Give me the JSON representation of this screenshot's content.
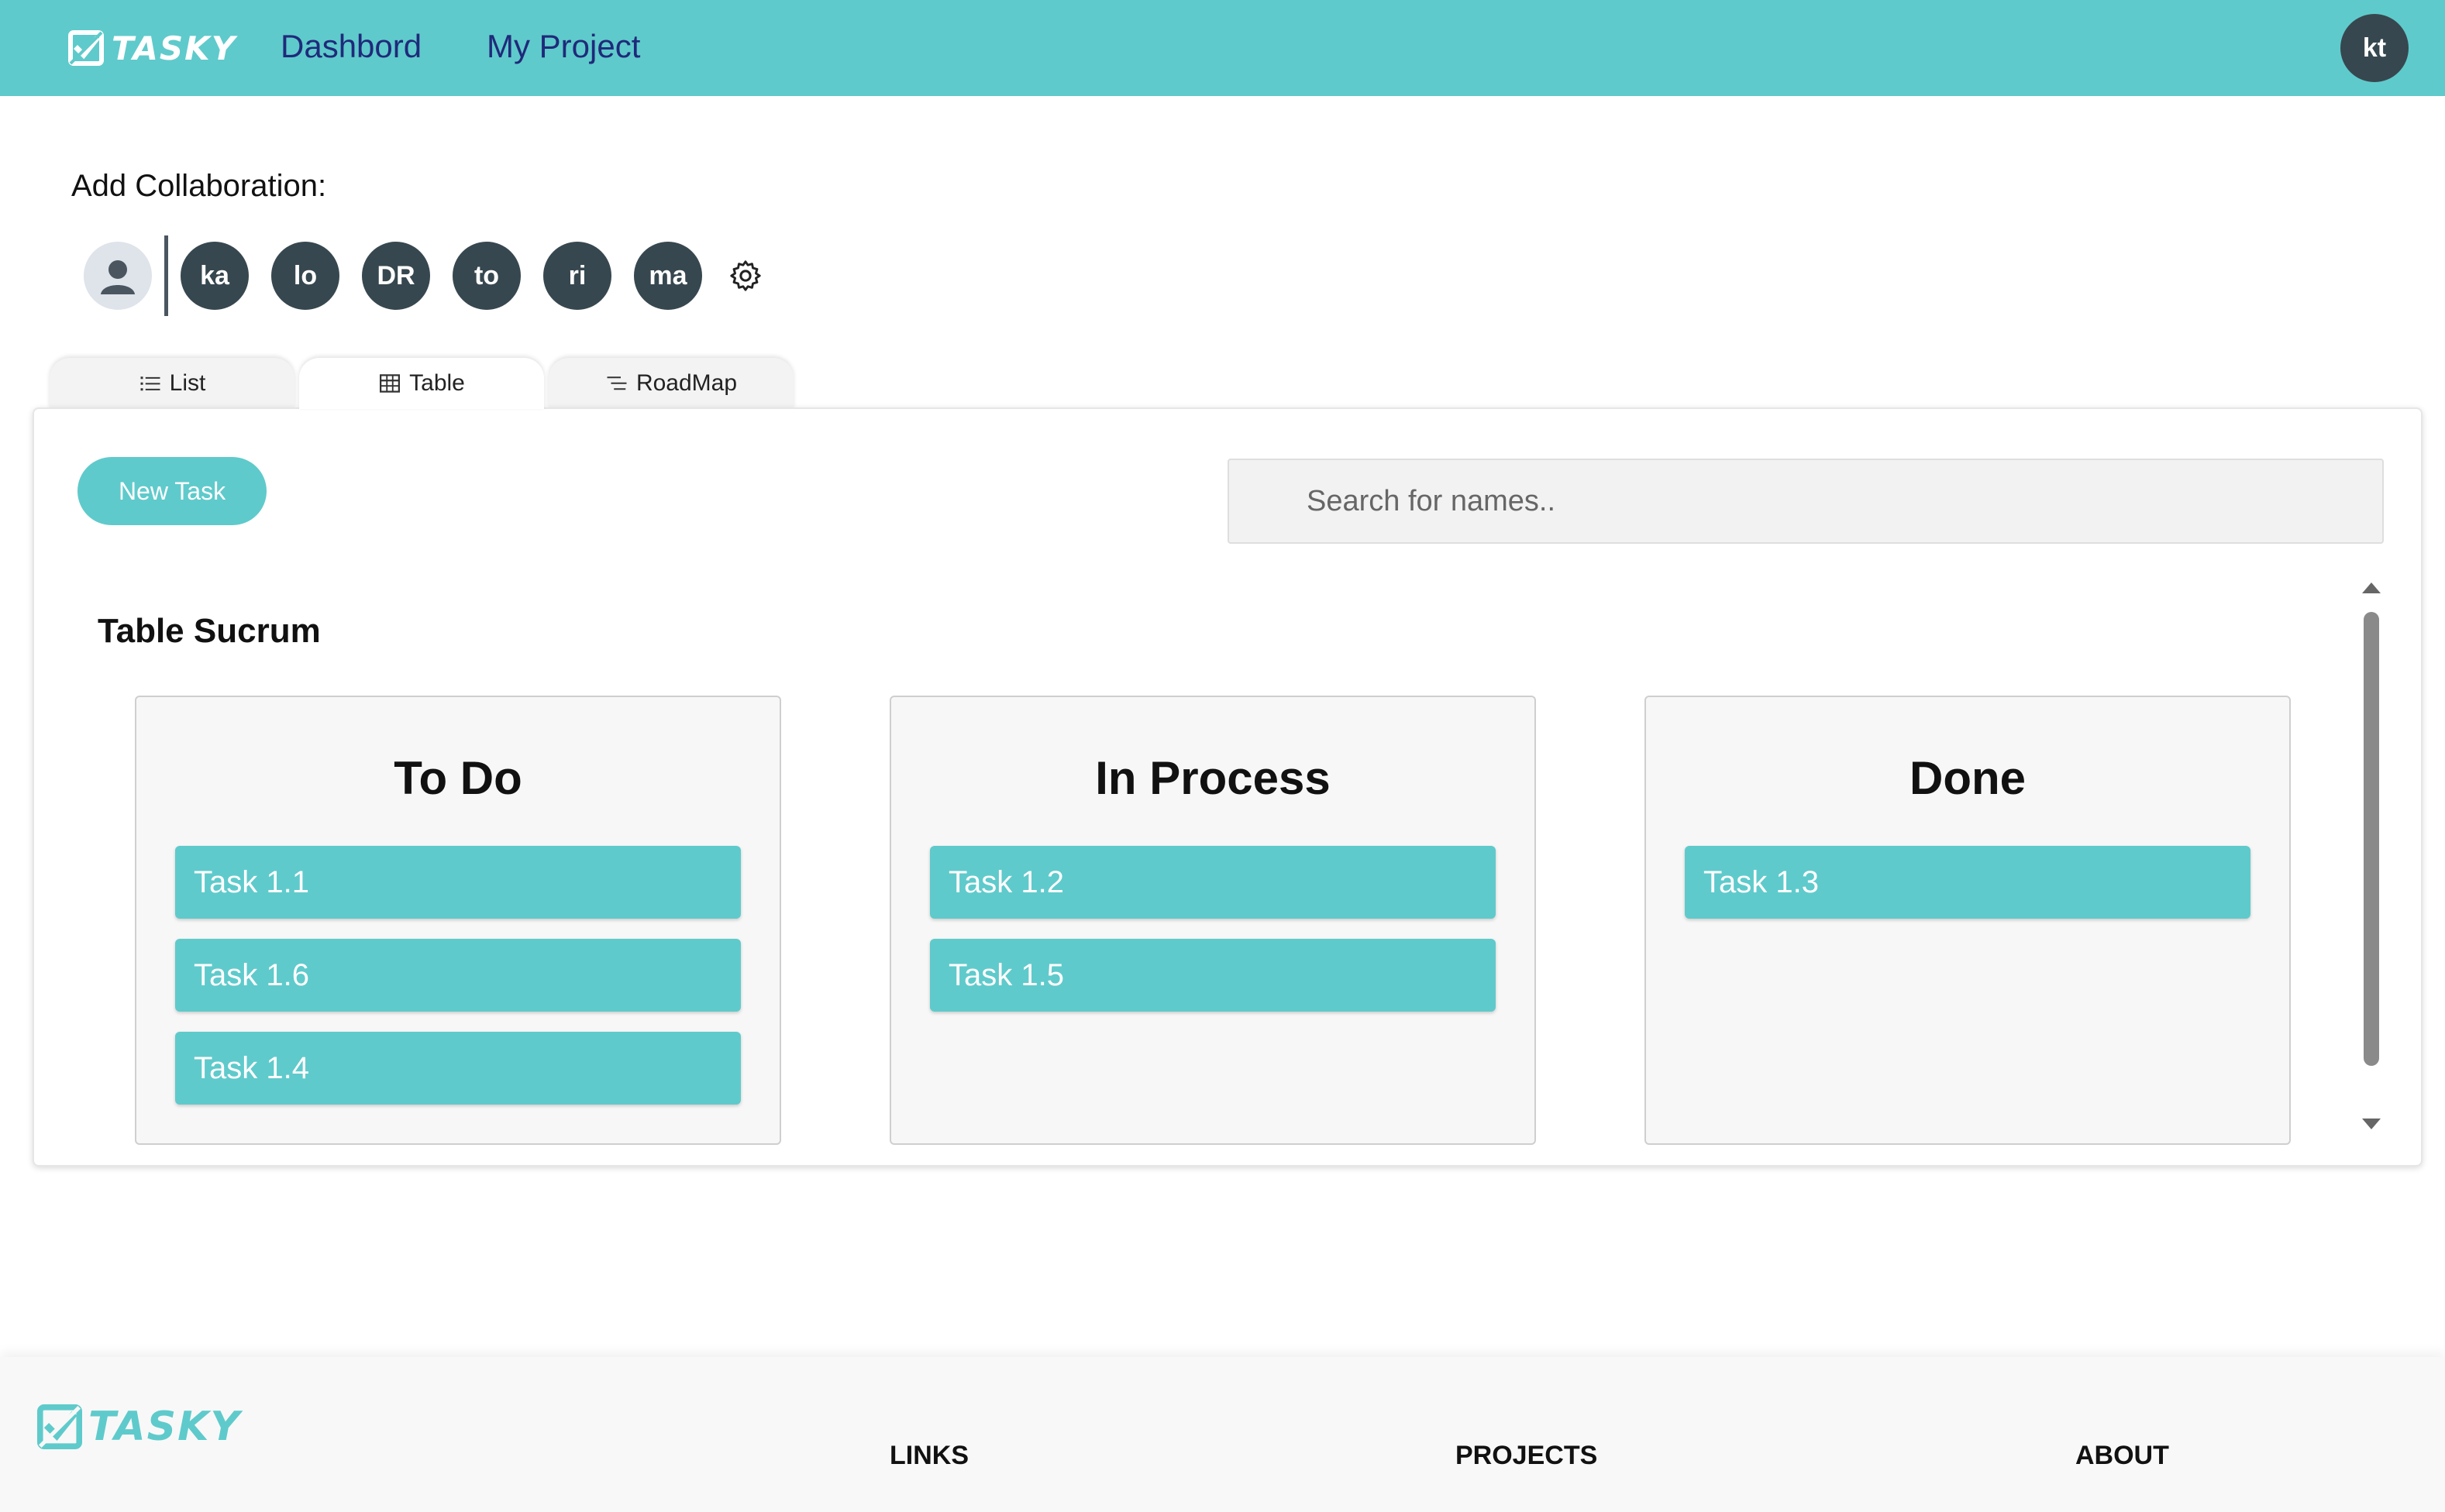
{
  "header": {
    "brand": "TASKY",
    "nav": [
      {
        "label": "Dashbord"
      },
      {
        "label": "My Project"
      }
    ],
    "user_initials": "kt"
  },
  "collaboration": {
    "label": "Add Collaboration:",
    "members": [
      "ka",
      "lo",
      "DR",
      "to",
      "ri",
      "ma"
    ]
  },
  "tabs": [
    {
      "label": "List",
      "icon": "list-icon",
      "active": false
    },
    {
      "label": "Table",
      "icon": "table-icon",
      "active": true
    },
    {
      "label": "RoadMap",
      "icon": "roadmap-icon",
      "active": false
    }
  ],
  "toolbar": {
    "new_task_label": "New Task",
    "search_placeholder": "Search for names.."
  },
  "board": {
    "title": "Table Sucrum",
    "columns": [
      {
        "title": "To Do",
        "tasks": [
          "Task 1.1",
          "Task 1.6",
          "Task 1.4"
        ]
      },
      {
        "title": "In Process",
        "tasks": [
          "Task 1.2",
          "Task 1.5"
        ]
      },
      {
        "title": "Done",
        "tasks": [
          "Task 1.3"
        ]
      }
    ]
  },
  "footer": {
    "brand": "TASKY",
    "links": [
      "LINKS",
      "PROJECTS",
      "ABOUT"
    ]
  },
  "colors": {
    "accent": "#5fcacb",
    "nav_text": "#1f2a7a",
    "avatar": "#37474f"
  }
}
